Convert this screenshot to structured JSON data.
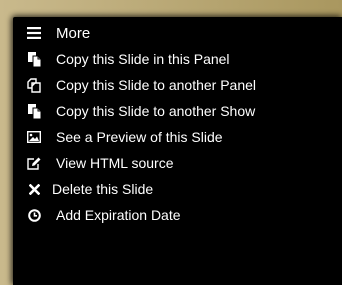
{
  "menu": {
    "header": {
      "label": "More",
      "icon": "hamburger-icon"
    },
    "items": [
      {
        "label": "Copy this Slide in this Panel",
        "icon": "copy-icon"
      },
      {
        "label": "Copy this Slide to another Panel",
        "icon": "duplicate-icon"
      },
      {
        "label": "Copy this Slide to another Show",
        "icon": "copy-icon"
      },
      {
        "label": "See a Preview of this Slide",
        "icon": "image-icon"
      },
      {
        "label": "View HTML source",
        "icon": "edit-icon"
      },
      {
        "label": "Delete this Slide",
        "icon": "close-icon"
      },
      {
        "label": "Add Expiration Date",
        "icon": "clock-icon"
      }
    ]
  },
  "colors": {
    "menu_background": "#000000",
    "menu_text": "#ffffff"
  }
}
